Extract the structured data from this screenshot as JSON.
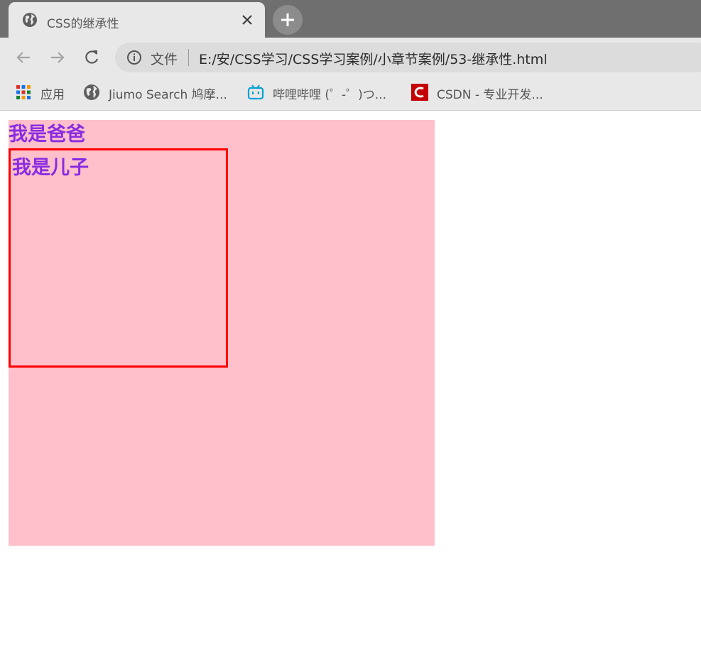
{
  "browser": {
    "tab": {
      "title": "CSS的继承性"
    },
    "address": {
      "scheme_label": "文件",
      "url": "E:/安/CSS学习/CSS学习案例/小章节案例/53-继承性.html"
    },
    "bookmarks": [
      {
        "label": "应用",
        "icon": "apps-grid-icon"
      },
      {
        "label": "Jiumo Search 鸠摩...",
        "icon": "globe-icon"
      },
      {
        "label": "哔哩哔哩 (゜-゜)つ...",
        "icon": "bilibili-icon"
      },
      {
        "label": "CSDN - 专业开发...",
        "icon": "csdn-icon"
      }
    ]
  },
  "content": {
    "father_text": "我是爸爸",
    "son_text": "我是儿子",
    "colors": {
      "father_bg": "#ffc0cb",
      "text": "#8a2be2",
      "son_border": "#ff0000"
    }
  }
}
